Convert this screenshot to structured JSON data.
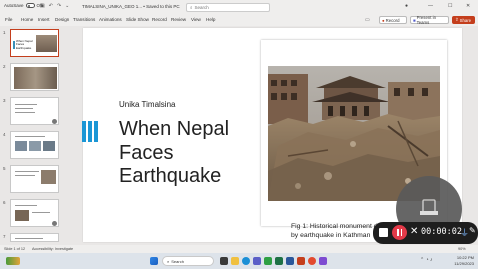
{
  "titlebar": {
    "autosave_label": "AutoSave",
    "autosave_state": "Off",
    "document_title": "TIMALSINA_UNIKA_GEO 1... • Saved to this PC",
    "search_placeholder": "Search"
  },
  "ribbon": {
    "tabs": [
      "File",
      "Home",
      "Insert",
      "Design",
      "Transitions",
      "Animations",
      "Slide Show",
      "Record",
      "Review",
      "View",
      "Help"
    ],
    "record_label": "Record",
    "present_label": "Present in Teams",
    "share_label": "Share"
  },
  "thumbnails": {
    "numbers": [
      "1",
      "2",
      "3",
      "4",
      "5",
      "6",
      "7"
    ],
    "slide1_title": "When Nepal Faces Earthquake"
  },
  "slide": {
    "author": "Unika Timalsina",
    "title_line1": "When Nepal",
    "title_line2": "Faces",
    "title_line3": "Earthquake",
    "caption_line1": "Fig 1: Historical monument destro",
    "caption_line2": "by earthquake in Kathman"
  },
  "recorder": {
    "timer": "00:00:02"
  },
  "statusbar": {
    "slide_info": "Slide 1 of 12",
    "accessibility": "Accessibility: Investigate",
    "zoom": "90%"
  },
  "taskbar": {
    "search_placeholder": "Search",
    "time": "10:22 PM",
    "date": "11/29/2023"
  },
  "colors": {
    "accent_red": "#c43e1c",
    "slide_blue": "#1a96d5"
  }
}
